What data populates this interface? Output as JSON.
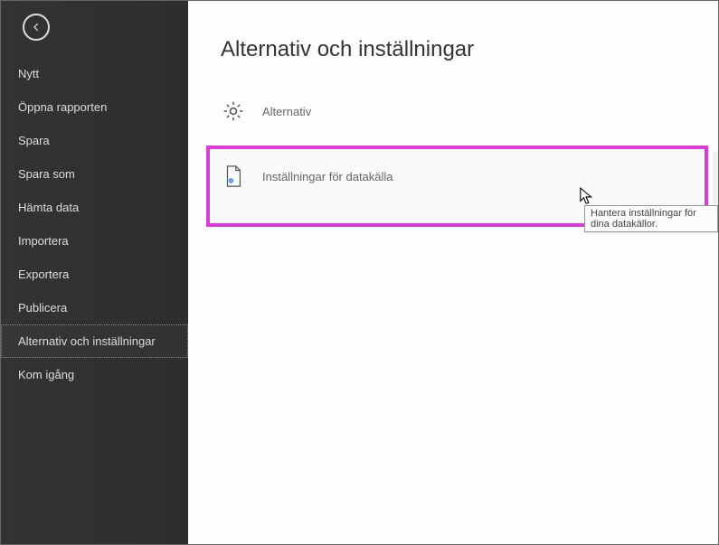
{
  "sidebar": {
    "items": [
      {
        "label": "Nytt"
      },
      {
        "label": "Öppna rapporten"
      },
      {
        "label": "Spara"
      },
      {
        "label": "Spara som"
      },
      {
        "label": "Hämta data"
      },
      {
        "label": "Importera"
      },
      {
        "label": "Exportera"
      },
      {
        "label": "Publicera"
      },
      {
        "label": "Alternativ och inställningar"
      },
      {
        "label": "Kom igång"
      }
    ],
    "selected_index": 8
  },
  "main": {
    "title": "Alternativ och inställningar",
    "options": [
      {
        "label": "Alternativ",
        "icon": "gear"
      },
      {
        "label": "Inställningar för datakälla",
        "icon": "doc-gear"
      }
    ],
    "tooltip": "Hantera inställningar för dina datakällor."
  }
}
